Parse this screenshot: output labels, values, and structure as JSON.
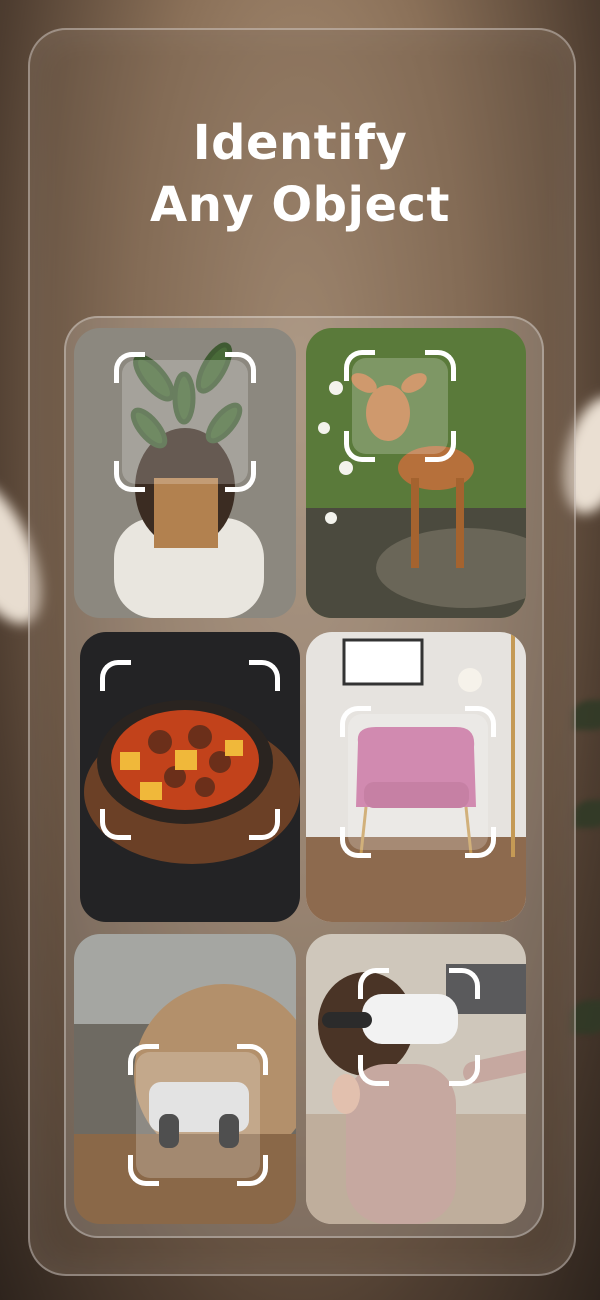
{
  "headline": {
    "line1": "Identify",
    "line2": "Any Object"
  },
  "colors": {
    "text": "#ffffff",
    "scan_frame": "#ffffff"
  },
  "tiles": [
    {
      "subject": "potted-plant",
      "icon": "scan-frame-icon"
    },
    {
      "subject": "fawn-deer",
      "icon": "scan-frame-icon"
    },
    {
      "subject": "stew-bowl",
      "icon": "scan-frame-icon"
    },
    {
      "subject": "pink-armchair",
      "icon": "scan-frame-icon"
    },
    {
      "subject": "rally-car",
      "icon": "scan-frame-icon"
    },
    {
      "subject": "vr-headset",
      "icon": "scan-frame-icon"
    }
  ]
}
